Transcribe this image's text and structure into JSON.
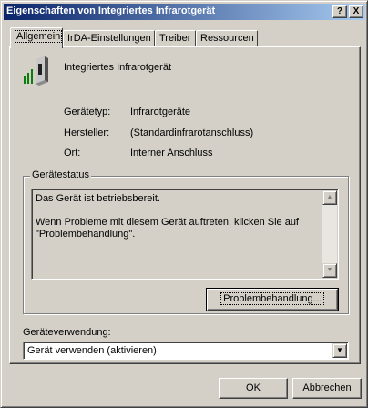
{
  "window": {
    "title": "Eigenschaften von Integriertes Infrarotgerät",
    "help_glyph": "?",
    "close_glyph": "X"
  },
  "tabs": [
    {
      "label": "Allgemein",
      "active": true
    },
    {
      "label": "IrDA-Einstellungen",
      "active": false
    },
    {
      "label": "Treiber",
      "active": false
    },
    {
      "label": "Ressourcen",
      "active": false
    }
  ],
  "device": {
    "name": "Integriertes Infrarotgerät",
    "icon": "infrared-device-icon"
  },
  "properties": [
    {
      "label": "Gerätetyp:",
      "value": "Infrarotgeräte"
    },
    {
      "label": "Hersteller:",
      "value": "(Standardinfrarotanschluss)"
    },
    {
      "label": "Ort:",
      "value": "Interner Anschluss"
    }
  ],
  "status_group": {
    "legend": "Gerätestatus",
    "line1": "Das Gerät ist betriebsbereit.",
    "line2": "Wenn Probleme mit diesem Gerät auftreten, klicken Sie auf \"Problembehandlung\".",
    "troubleshoot_label": "Problembehandlung..."
  },
  "usage": {
    "label": "Geräteverwendung:",
    "selected": "Gerät verwenden (aktivieren)"
  },
  "footer": {
    "ok_label": "OK",
    "cancel_label": "Abbrechen"
  },
  "colors": {
    "title_start": "#0a246a",
    "title_end": "#a6caf0",
    "face": "#d4d0c8"
  }
}
